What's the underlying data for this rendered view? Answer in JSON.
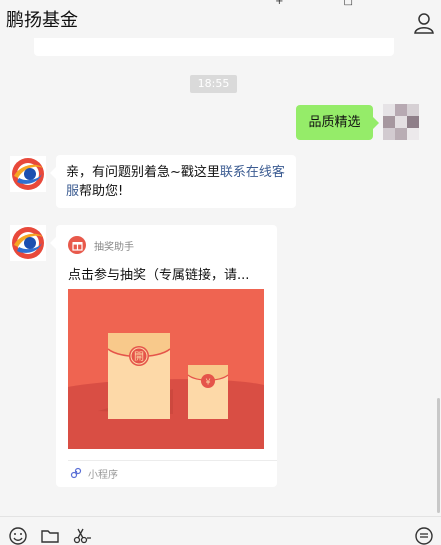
{
  "header": {
    "title": "鹏扬基金",
    "top_icons": [
      "+",
      "□"
    ],
    "profile_icon": "user-profile-icon"
  },
  "chat": {
    "timestamp": "18:55",
    "outgoing": {
      "text": "品质精选"
    },
    "incoming_text": {
      "part1": "亲，有问题别着急~戳这里",
      "link": "联系在线客服",
      "part2": "帮助您!"
    },
    "mini_program": {
      "source": "抽奖助手",
      "title": "点击参与抽奖（专属链接，请...",
      "big_envelope_char": "開",
      "small_envelope_char": "¥",
      "footer": "小程序"
    }
  },
  "toolbar": {
    "icons": [
      "emoji-icon",
      "folder-icon",
      "scissors-icon"
    ]
  },
  "colors": {
    "background": "#f5f5f5",
    "outgoing_bubble": "#95ec69",
    "link": "#3b5b91",
    "cover_red": "#ef6451",
    "envelope": "#fdd9a8"
  }
}
